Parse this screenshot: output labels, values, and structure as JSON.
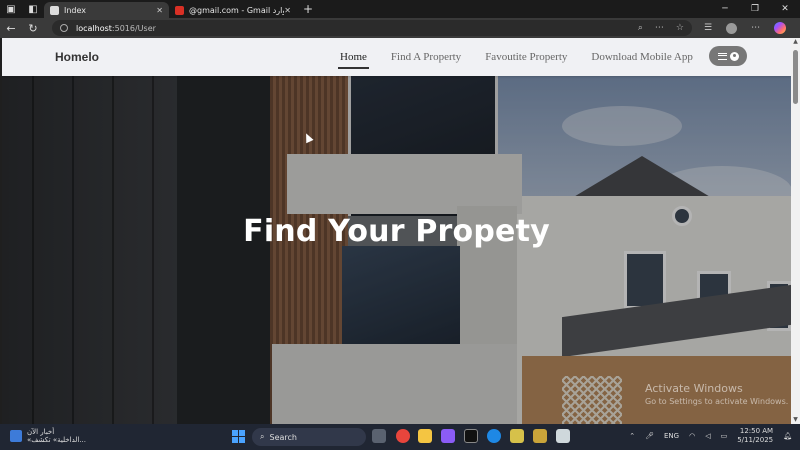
{
  "browser": {
    "tabs": [
      {
        "title": "Index",
        "active": true
      },
      {
        "title": "@gmail.com - Gmail البريد الوارد",
        "active": false
      }
    ],
    "url_host": "localhost",
    "url_path": ":5016/User"
  },
  "site": {
    "brand": "Homelo",
    "nav": [
      "Home",
      "Find A Property",
      "Favoutite Property",
      "Download Mobile App"
    ],
    "active_nav": "Home",
    "hero_title": "Find Your Propety"
  },
  "watermark": {
    "title": "Activate Windows",
    "subtitle": "Go to Settings to activate Windows."
  },
  "taskbar": {
    "news_line1": "أخبار الآن",
    "news_line2": "«الداخلية» تكشف...",
    "search_label": "Search",
    "language": "ENG",
    "time": "12:50 AM",
    "date": "5/11/2025"
  },
  "colors": {
    "nav_bg": "#f0f1f4",
    "menu_pill": "#777777",
    "taskbar": "#202633"
  }
}
